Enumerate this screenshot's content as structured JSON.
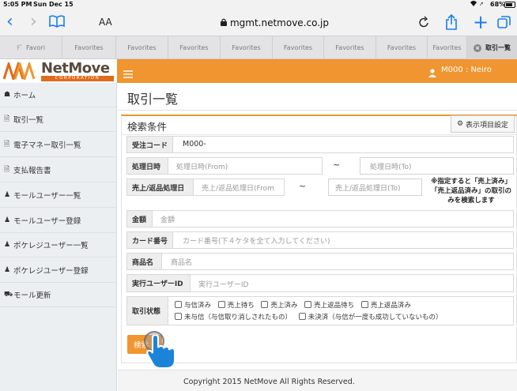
{
  "status_bar": {
    "time": "5:05 PM",
    "date": "Sun Dec 15",
    "battery": "68%"
  },
  "browser": {
    "text_size": "AA",
    "url": "mgmt.netmove.co.jp",
    "favorites": [
      "Favori",
      "Favorites",
      "Favorites",
      "Favorites",
      "Favorites",
      "Favorites",
      "Favorites",
      "Favorites",
      "Favorites"
    ],
    "active_tab": "取引一覧"
  },
  "header": {
    "logo_name": "NetMove",
    "logo_sub": "CORPORATION",
    "user": "M000 : Neiro"
  },
  "sidebar": {
    "items": [
      {
        "icon": "home-icon",
        "label": "ホーム"
      },
      {
        "icon": "document-icon",
        "label": "取引一覧"
      },
      {
        "icon": "document-icon",
        "label": "電子マネー取引一覧"
      },
      {
        "icon": "document-icon",
        "label": "支払報告書"
      },
      {
        "icon": "user-icon",
        "label": "モールユーザー一覧"
      },
      {
        "icon": "user-icon",
        "label": "モールユーザー登録"
      },
      {
        "icon": "users-icon",
        "label": "ポケレジユーザー一覧"
      },
      {
        "icon": "users-icon",
        "label": "ポケレジユーザー登録"
      },
      {
        "icon": "cart-icon",
        "label": "モール更新"
      }
    ]
  },
  "main": {
    "page_title": "取引一覧",
    "panel_title": "検索条件",
    "display_settings": "表示項目設定",
    "fields": {
      "order_code": {
        "label": "受注コード",
        "value": "M000-"
      },
      "process_date": {
        "label": "処理日時",
        "from_placeholder": "処理日時(From)",
        "to_placeholder": "処理日時(To)",
        "tilde": "~"
      },
      "sale_date": {
        "label": "売上/返品処理日",
        "from_placeholder": "売上/返品処理日(From",
        "to_placeholder": "売上/返品処理日(To)",
        "tilde": "~",
        "note_lines": [
          "※指定すると「売上済み」",
          "「売上返品済み」の取引の",
          "みを検索します"
        ]
      },
      "amount": {
        "label": "金額",
        "placeholder": "金額"
      },
      "card_number": {
        "label": "カード番号",
        "placeholder": "カード番号(下４ケタを全て入力してください)"
      },
      "product_name": {
        "label": "商品名",
        "placeholder": "商品名"
      },
      "exec_user": {
        "label": "実行ユーザーID",
        "placeholder": "実行ユーザーID"
      },
      "status": {
        "label": "取引状態",
        "options_row1": [
          "与信済み",
          "売上待ち",
          "売上済み",
          "売上返品待ち",
          "売上返品済み"
        ],
        "options_row2": [
          "未与信（与信取り消しされたもの）",
          "未決済（与信が一度も成功していないもの）"
        ]
      }
    },
    "search_button": "検索",
    "footer": "Copyright 2015 NetMove All Rights Reserved."
  },
  "colors": {
    "accent": "#f0952f",
    "sidebar_bg": "#eceff1",
    "ios_blue": "#1a7cf2"
  }
}
